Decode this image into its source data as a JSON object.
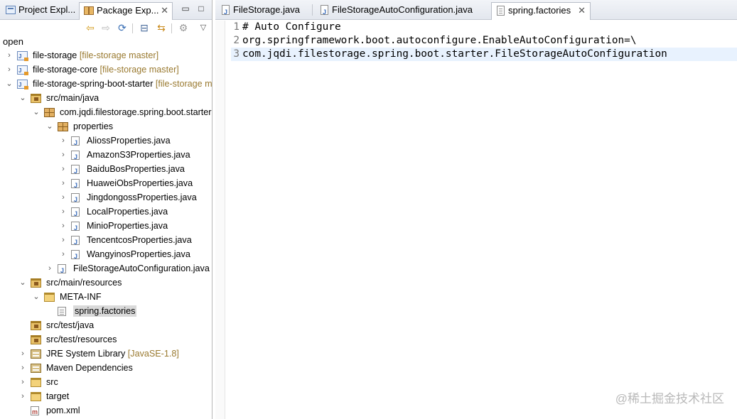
{
  "left_panel": {
    "tabs": [
      {
        "label": "Project Expl...",
        "active": false
      },
      {
        "label": "Package Exp...",
        "active": true
      }
    ],
    "close_glyph": "✕",
    "minimize_glyph": "▭",
    "maximize_glyph": "□",
    "toolbar": {
      "back_icon": "⇦",
      "forward_icon": "⇨",
      "sync_icon": "⟳",
      "collapse_icon": "⊟",
      "link_icon": "⇆",
      "filter_icon": "⚙",
      "menu_icon": "▽"
    },
    "filter_text": "open",
    "tree": [
      {
        "label": "file-storage",
        "decoration": "[file-storage master]",
        "depth": 0,
        "icon": "project",
        "arrow": "›"
      },
      {
        "label": "file-storage-core",
        "decoration": "[file-storage master]",
        "depth": 0,
        "icon": "project",
        "arrow": "›"
      },
      {
        "label": "file-storage-spring-boot-starter",
        "decoration": "[file-storage master]",
        "depth": 0,
        "icon": "project",
        "arrow": "⌄"
      },
      {
        "label": "src/main/java",
        "decoration": "",
        "depth": 1,
        "icon": "srcfolder",
        "arrow": "⌄"
      },
      {
        "label": "com.jqdi.filestorage.spring.boot.starter",
        "decoration": "",
        "depth": 2,
        "icon": "package",
        "arrow": "⌄"
      },
      {
        "label": "properties",
        "decoration": "",
        "depth": 3,
        "icon": "package",
        "arrow": "⌄"
      },
      {
        "label": "AliossProperties.java",
        "decoration": "",
        "depth": 4,
        "icon": "java",
        "arrow": "›"
      },
      {
        "label": "AmazonS3Properties.java",
        "decoration": "",
        "depth": 4,
        "icon": "java",
        "arrow": "›"
      },
      {
        "label": "BaiduBosProperties.java",
        "decoration": "",
        "depth": 4,
        "icon": "java",
        "arrow": "›"
      },
      {
        "label": "HuaweiObsProperties.java",
        "decoration": "",
        "depth": 4,
        "icon": "java",
        "arrow": "›"
      },
      {
        "label": "JingdongossProperties.java",
        "decoration": "",
        "depth": 4,
        "icon": "java",
        "arrow": "›"
      },
      {
        "label": "LocalProperties.java",
        "decoration": "",
        "depth": 4,
        "icon": "java",
        "arrow": "›"
      },
      {
        "label": "MinioProperties.java",
        "decoration": "",
        "depth": 4,
        "icon": "java",
        "arrow": "›"
      },
      {
        "label": "TencentcosProperties.java",
        "decoration": "",
        "depth": 4,
        "icon": "java",
        "arrow": "›"
      },
      {
        "label": "WangyinosProperties.java",
        "decoration": "",
        "depth": 4,
        "icon": "java",
        "arrow": "›"
      },
      {
        "label": "FileStorageAutoConfiguration.java",
        "decoration": "",
        "depth": 3,
        "icon": "java",
        "arrow": "›"
      },
      {
        "label": "src/main/resources",
        "decoration": "",
        "depth": 1,
        "icon": "srcfolder",
        "arrow": "⌄"
      },
      {
        "label": "META-INF",
        "decoration": "",
        "depth": 2,
        "icon": "folder",
        "arrow": "⌄"
      },
      {
        "label": "spring.factories",
        "decoration": "",
        "depth": 3,
        "icon": "file",
        "arrow": "",
        "selected": true
      },
      {
        "label": "src/test/java",
        "decoration": "",
        "depth": 1,
        "icon": "srcfolder",
        "arrow": ""
      },
      {
        "label": "src/test/resources",
        "decoration": "",
        "depth": 1,
        "icon": "srcfolder",
        "arrow": ""
      },
      {
        "label": "JRE System Library",
        "decoration": "[JavaSE-1.8]",
        "depth": 1,
        "icon": "library",
        "arrow": "›"
      },
      {
        "label": "Maven Dependencies",
        "decoration": "",
        "depth": 1,
        "icon": "library",
        "arrow": "›"
      },
      {
        "label": "src",
        "decoration": "",
        "depth": 1,
        "icon": "folder",
        "arrow": "›"
      },
      {
        "label": "target",
        "decoration": "",
        "depth": 1,
        "icon": "folder",
        "arrow": "›"
      },
      {
        "label": "pom.xml",
        "decoration": "",
        "depth": 1,
        "icon": "xml",
        "arrow": ""
      }
    ]
  },
  "editor": {
    "tabs": [
      {
        "label": "FileStorage.java",
        "icon": "java",
        "active": false
      },
      {
        "label": "FileStorageAutoConfiguration.java",
        "icon": "java",
        "active": false
      },
      {
        "label": "spring.factories",
        "icon": "file",
        "active": true
      }
    ],
    "close_glyph": "✕",
    "lines": [
      {
        "number": "1",
        "text": "# Auto Configure"
      },
      {
        "number": "2",
        "text": "org.springframework.boot.autoconfigure.EnableAutoConfiguration=\\"
      },
      {
        "number": "3",
        "text": "com.jqdi.filestorage.spring.boot.starter.FileStorageAutoConfiguration"
      }
    ],
    "current_line": 3
  },
  "watermark": "@稀土掘金技术社区",
  "colors": {
    "selection": "#d9d9d9",
    "current_line": "#e8f2fe",
    "decoration": "#9a7a30",
    "line_number": "#787878"
  }
}
